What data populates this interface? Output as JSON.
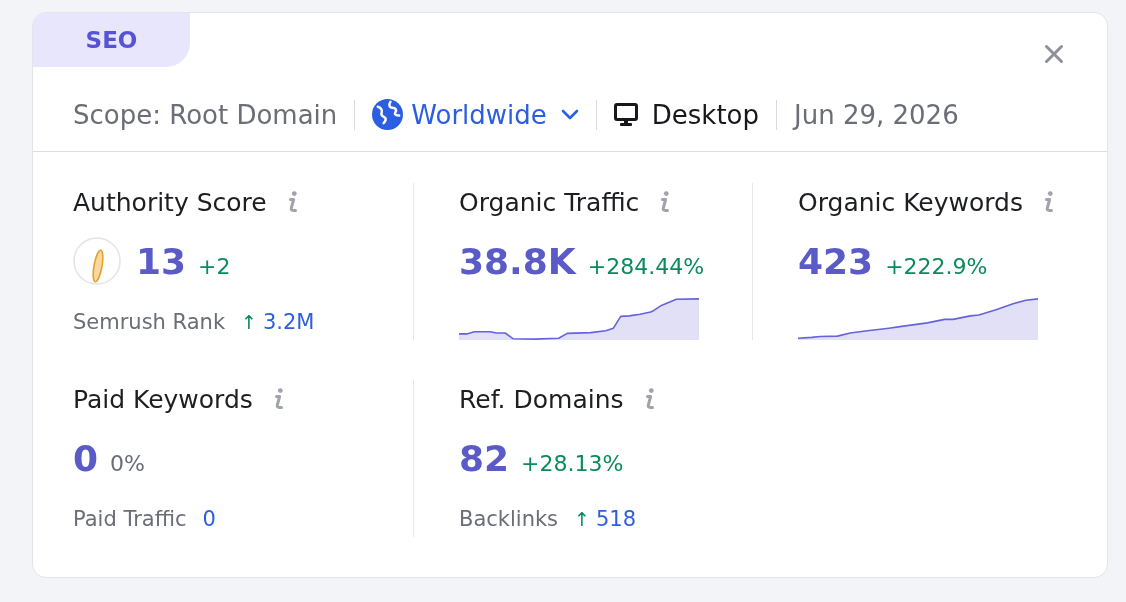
{
  "section_tab": {
    "label": "SEO"
  },
  "filters": [
    {
      "kind": "scope",
      "label": "Scope: Root Domain"
    },
    {
      "kind": "location",
      "label": "Worldwide"
    },
    {
      "kind": "device",
      "label": "Desktop"
    },
    {
      "kind": "date",
      "label": "Jun 29, 2026"
    }
  ],
  "metrics": [
    {
      "kind": "score",
      "title": "Authority Score",
      "value": "13",
      "change": "+2",
      "positive": true,
      "sub_label": "Semrush Rank",
      "sub_arrow": "↑",
      "sub_value": "3.2M"
    },
    {
      "kind": "sparkline",
      "title": "Organic Traffic",
      "value": "38.8K",
      "change": "+284.44%",
      "positive": true
    },
    {
      "kind": "sparkline",
      "title": "Organic Keywords",
      "value": "423",
      "change": "+222.9%",
      "positive": true
    },
    {
      "kind": "plain",
      "title": "Paid Keywords",
      "value": "0",
      "change": "0%",
      "positive": false,
      "sub_label": "Paid Traffic",
      "sub_value": "0"
    },
    {
      "kind": "plain",
      "title": "Ref. Domains",
      "value": "82",
      "change": "+28.13%",
      "positive": true,
      "sub_label": "Backlinks",
      "sub_arrow": "↑",
      "sub_value": "518"
    }
  ]
}
